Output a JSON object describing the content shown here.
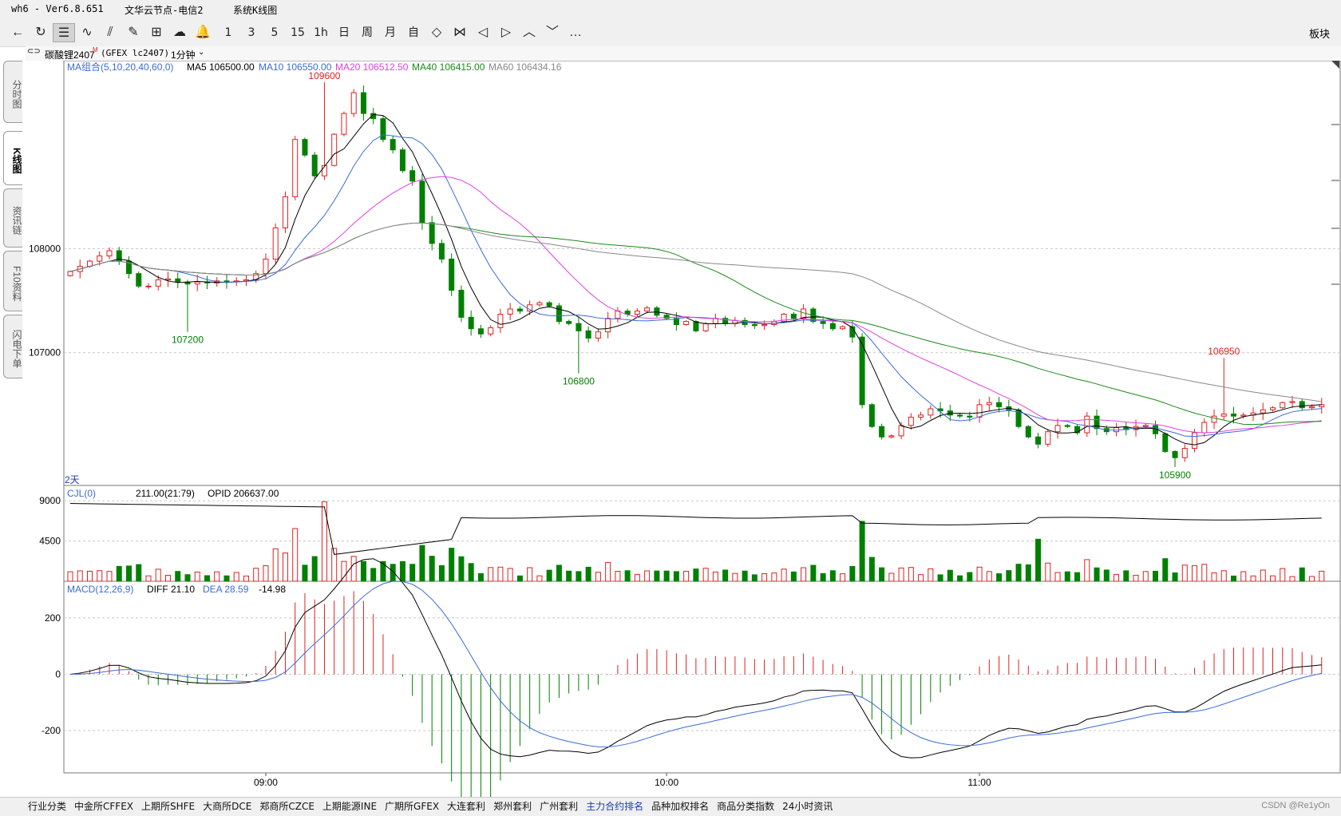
{
  "title": {
    "app": "wh6  -  Ver6.8.651",
    "node": "文华云节点-电信2",
    "menu": "系统K线图"
  },
  "toolbar": {
    "buttons": [
      {
        "name": "back-arrow-icon",
        "glyph": "←"
      },
      {
        "name": "refresh-icon",
        "glyph": "↻"
      },
      {
        "name": "list-icon",
        "glyph": "☰",
        "active": true
      },
      {
        "name": "line-chart-icon",
        "glyph": "∿"
      },
      {
        "name": "candle-icon",
        "glyph": "⫽"
      },
      {
        "name": "draw-tool-icon",
        "glyph": "✎"
      },
      {
        "name": "calculator-icon",
        "glyph": "⊞"
      },
      {
        "name": "cloud-icon",
        "glyph": "☁"
      },
      {
        "name": "bell-icon",
        "glyph": "🔔"
      },
      {
        "name": "period-1",
        "text": "1"
      },
      {
        "name": "period-3",
        "text": "3"
      },
      {
        "name": "period-5",
        "text": "5"
      },
      {
        "name": "period-15",
        "text": "15"
      },
      {
        "name": "period-1h",
        "text": "1h"
      },
      {
        "name": "period-day",
        "text": "日"
      },
      {
        "name": "period-week",
        "text": "周"
      },
      {
        "name": "period-month",
        "text": "月"
      },
      {
        "name": "period-custom",
        "text": "自"
      },
      {
        "name": "zoom-out-icon",
        "glyph": "◇"
      },
      {
        "name": "zoom-in-icon",
        "glyph": "⋈"
      },
      {
        "name": "scroll-left-icon",
        "glyph": "◁"
      },
      {
        "name": "scroll-right-icon",
        "glyph": "▷"
      },
      {
        "name": "expand-up-icon",
        "glyph": "︿"
      },
      {
        "name": "collapse-down-icon",
        "glyph": "﹀"
      },
      {
        "name": "more-icon",
        "glyph": "…"
      }
    ],
    "panel_label": "板块"
  },
  "left_tabs": [
    {
      "label": "分时图",
      "active": false
    },
    {
      "label": "K线图",
      "active": true
    },
    {
      "label": "资讯链",
      "active": false
    },
    {
      "label": "F10资料",
      "active": false
    },
    {
      "label": "闪电下单",
      "active": false
    }
  ],
  "symbol": {
    "name": "碳酸锂2407",
    "tag": "M",
    "code": "(GFEX lc2407)",
    "period": "1分钟"
  },
  "ma_legend": {
    "group": "MA组合(5,10,20,40,60,0)",
    "ma5": "MA5 106500.00",
    "ma10": "MA10 106550.00",
    "ma20": "MA20 106512.50",
    "ma40": "MA40 106415.00",
    "ma60": "MA60 106434.16",
    "color_ma5": "#000000",
    "color_ma10": "#3a6bd8",
    "color_ma20": "#e040e0",
    "color_ma40": "#1a8a1a",
    "color_ma60": "#888888"
  },
  "price_axis": [
    "108000",
    "107000"
  ],
  "price_annotations": [
    "109600",
    "107200",
    "106800",
    "106950",
    "105900"
  ],
  "range_label": "2天",
  "volume_legend": {
    "name": "CJL(0)",
    "value": "211.00(21:79)",
    "opid": "OPID 206637.00"
  },
  "volume_axis": [
    "9000",
    "4500"
  ],
  "macd_legend": {
    "name": "MACD(12,26,9)",
    "diff": "DIFF 21.10",
    "dea": "DEA 28.59",
    "macd": "-14.98"
  },
  "macd_axis": [
    "200",
    "0",
    "-200"
  ],
  "time_axis": [
    "09:00",
    "10:00",
    "11:00"
  ],
  "bottom_tabs": [
    "行业分类",
    "中金所CFFEX",
    "上期所SHFE",
    "大商所DCE",
    "郑商所CZCE",
    "上期能源INE",
    "广期所GFEX",
    "大连套利",
    "郑州套利",
    "广州套利",
    "主力合约排名",
    "品种加权排名",
    "商品分类指数",
    "24小时资讯"
  ],
  "bottom_highlight": "主力合约排名",
  "watermark": "CSDN @Re1yOn",
  "colors": {
    "up": "#e02020",
    "down": "#008000",
    "grid": "#c8c8c8"
  },
  "chart_data": {
    "type": "candlestick",
    "close_series": [
      107780,
      107830,
      107880,
      107930,
      107980,
      107880,
      107760,
      107640,
      107640,
      107700,
      107710,
      107680,
      107660,
      107680,
      107670,
      107690,
      107680,
      107690,
      107700,
      107760,
      107900,
      108200,
      108500,
      109050,
      108900,
      108700,
      108800,
      109100,
      109300,
      109500,
      109300,
      109250,
      109050,
      108950,
      108750,
      108650,
      108250,
      108050,
      107900,
      107600,
      107340,
      107230,
      107180,
      107240,
      107370,
      107420,
      107400,
      107460,
      107480,
      107450,
      107300,
      107280,
      107210,
      107140,
      107200,
      107330,
      107400,
      107370,
      107400,
      107430,
      107360,
      107330,
      107270,
      107300,
      107210,
      107280,
      107330,
      107280,
      107310,
      107270,
      107260,
      107270,
      107300,
      107370,
      107330,
      107420,
      107300,
      107280,
      107230,
      107250,
      107150,
      106500,
      106290,
      106190,
      106200,
      106300,
      106380,
      106400,
      106460,
      106440,
      106400,
      106390,
      106380,
      106500,
      106520,
      106480,
      106450,
      106290,
      106190,
      106120,
      106240,
      106300,
      106290,
      106230,
      106390,
      106270,
      106240,
      106280,
      106260,
      106290,
      106300,
      106220,
      106050,
      105990,
      106080,
      106230,
      106330,
      106390,
      106410,
      106390,
      106400,
      106420,
      106450,
      106470,
      106520,
      106530,
      106470,
      106480,
      106500
    ],
    "ylim": [
      105800,
      109700
    ],
    "volume_ylim": [
      0,
      10000
    ],
    "macd_ylim": [
      -350,
      330
    ]
  }
}
